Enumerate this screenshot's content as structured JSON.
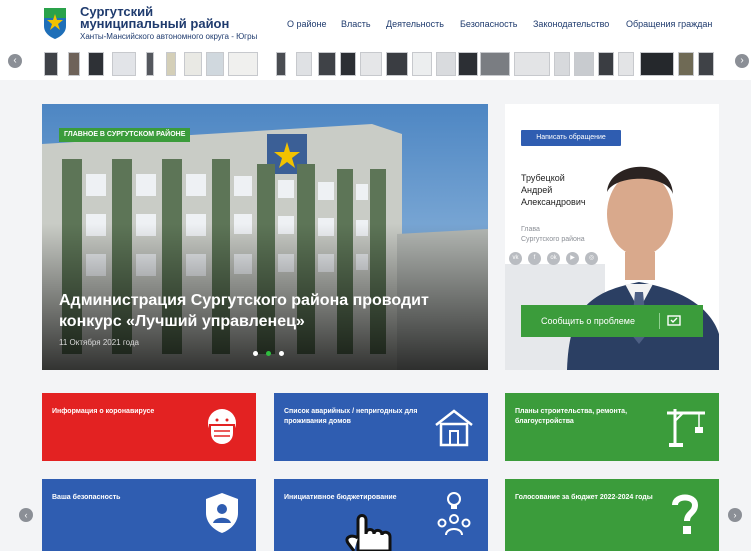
{
  "site": {
    "title_line1": "Сургутский",
    "title_line2": "муниципальный район",
    "subtitle": "Ханты-Мансийского автономного округа - Югры"
  },
  "nav": [
    "О районе",
    "Власть",
    "Деятельность",
    "Безопасность",
    "Законодательство",
    "Обращения граждан"
  ],
  "strip": {
    "prev": "‹",
    "next": "›"
  },
  "hero": {
    "badge": "ГЛАВНОЕ В СУРГУТСКОМ РАЙОНЕ",
    "title": "Администрация Сургутского района проводит конкурс «Лучший управленец»",
    "date": "11 Октября 2021 года",
    "slides": 3,
    "active_slide": 2
  },
  "person": {
    "write_button": "Написать обращение",
    "name_line1": "Трубецкой",
    "name_line2": "Андрей",
    "name_line3": "Александрович",
    "role_line1": "Глава",
    "role_line2": "Сургутского района",
    "social_icons": [
      "vk-icon",
      "odnoklassniki-icon",
      "ok-icon",
      "youtube-icon",
      "instagram-icon"
    ],
    "report_button": "Сообщить о проблеме"
  },
  "tiles": [
    {
      "label": "Информация о коронавирусе",
      "color": "#e32222",
      "icon": "mask-icon"
    },
    {
      "label": "Список аварийных / непригодных для проживания домов",
      "color": "#2f5db1",
      "icon": "house-icon"
    },
    {
      "label": "Планы строительства, ремонта, благоустройства",
      "color": "#3b9c3b",
      "icon": "crane-icon"
    },
    {
      "label": "Ваша безопасность",
      "color": "#2f5db1",
      "icon": "shield-icon"
    },
    {
      "label": "Инициативное бюджетирование",
      "color": "#2f5db1",
      "icon": "idea-people-icon"
    },
    {
      "label": "Голосование за бюджет 2022-2024 годы",
      "color": "#3b9c3b",
      "icon": "question-icon"
    }
  ],
  "side_arrows": {
    "prev": "‹",
    "next": "›"
  }
}
